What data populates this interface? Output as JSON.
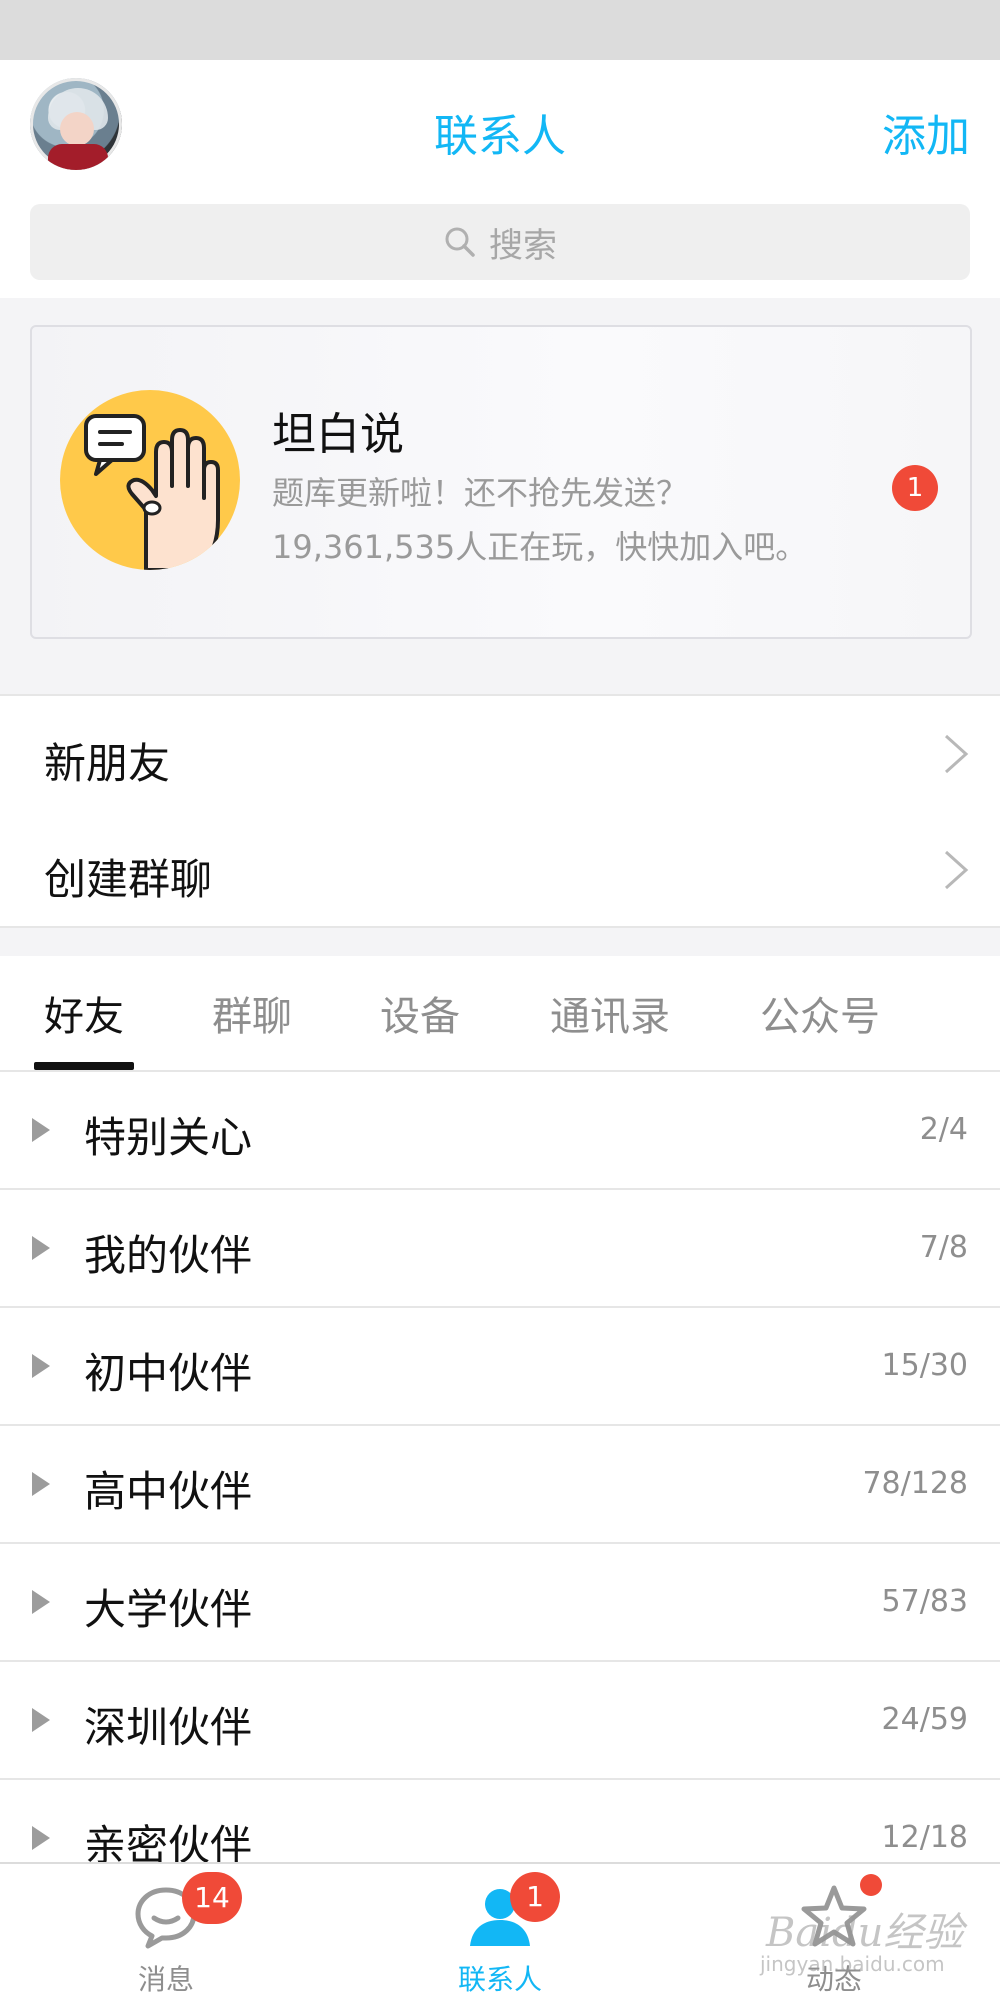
{
  "header": {
    "title": "联系人",
    "add_label": "添加"
  },
  "search": {
    "placeholder": "搜索"
  },
  "promo": {
    "title": "坦白说",
    "line1": "题库更新啦！还不抢先发送？",
    "line2": "19,361,535人正在玩，快快加入吧。",
    "badge": "1"
  },
  "menu": [
    {
      "label": "新朋友"
    },
    {
      "label": "创建群聊"
    }
  ],
  "tabs": [
    {
      "label": "好友",
      "active": true
    },
    {
      "label": "群聊",
      "active": false
    },
    {
      "label": "设备",
      "active": false
    },
    {
      "label": "通讯录",
      "active": false
    },
    {
      "label": "公众号",
      "active": false
    }
  ],
  "groups": [
    {
      "name": "特别关心",
      "count": "2/4"
    },
    {
      "name": "我的伙伴",
      "count": "7/8"
    },
    {
      "name": "初中伙伴",
      "count": "15/30"
    },
    {
      "name": "高中伙伴",
      "count": "78/128"
    },
    {
      "name": "大学伙伴",
      "count": "57/83"
    },
    {
      "name": "深圳伙伴",
      "count": "24/59"
    },
    {
      "name": "亲密伙伴",
      "count": "12/18"
    }
  ],
  "tabbar": {
    "items": [
      {
        "label": "消息",
        "badge": "14",
        "icon": "chat-bubble-icon"
      },
      {
        "label": "联系人",
        "badge": "1",
        "icon": "person-icon",
        "active": true
      },
      {
        "label": "动态",
        "badge": "",
        "icon": "star-icon"
      }
    ]
  },
  "watermark": {
    "brand": "Baidu经验",
    "url": "jingyan.baidu.com"
  },
  "colors": {
    "accent": "#12b7f5",
    "badge": "#f04a38",
    "promo_icon_bg": "#ffc94a"
  }
}
